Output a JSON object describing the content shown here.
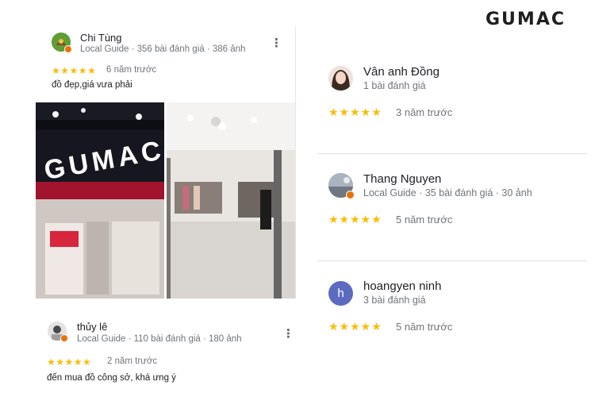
{
  "brand": "GUMAC",
  "star_glyphs": "★★★★★",
  "review_left_top": {
    "name": "Chi Tùng",
    "meta": "Local Guide · 356 bài đánh giá · 386 ảnh",
    "rating": 5,
    "ago": "6 năm trước",
    "comment": "đồ đẹp,giá vưa phải",
    "photos": [
      "storefront-photo",
      "store-interior-photo"
    ],
    "photo_sign_text": "GUMAC"
  },
  "review_left_bottom": {
    "name": "thủy lê",
    "meta": "Local Guide · 110 bài đánh giá · 180 ảnh",
    "rating": 5,
    "ago": "2 năm trước",
    "comment": "đến mua đồ công sở, khá ưng ý"
  },
  "reviews_right": [
    {
      "name": "Vân anh Đồng",
      "meta": "1 bài đánh giá",
      "rating": 5,
      "ago": "3 năm trước"
    },
    {
      "name": "Thang Nguyen",
      "meta": "Local Guide · 35 bài đánh giá · 30 ảnh",
      "rating": 5,
      "ago": "5 năm trước"
    },
    {
      "name": "hoangyen ninh",
      "meta": "3 bài đánh giá",
      "rating": 5,
      "ago": "5 năm trước",
      "initial": "h"
    }
  ],
  "colors": {
    "star": "#fbbc04",
    "local_guide_badge": "#e8710a",
    "initial_avatar": "#5c6bc0"
  }
}
